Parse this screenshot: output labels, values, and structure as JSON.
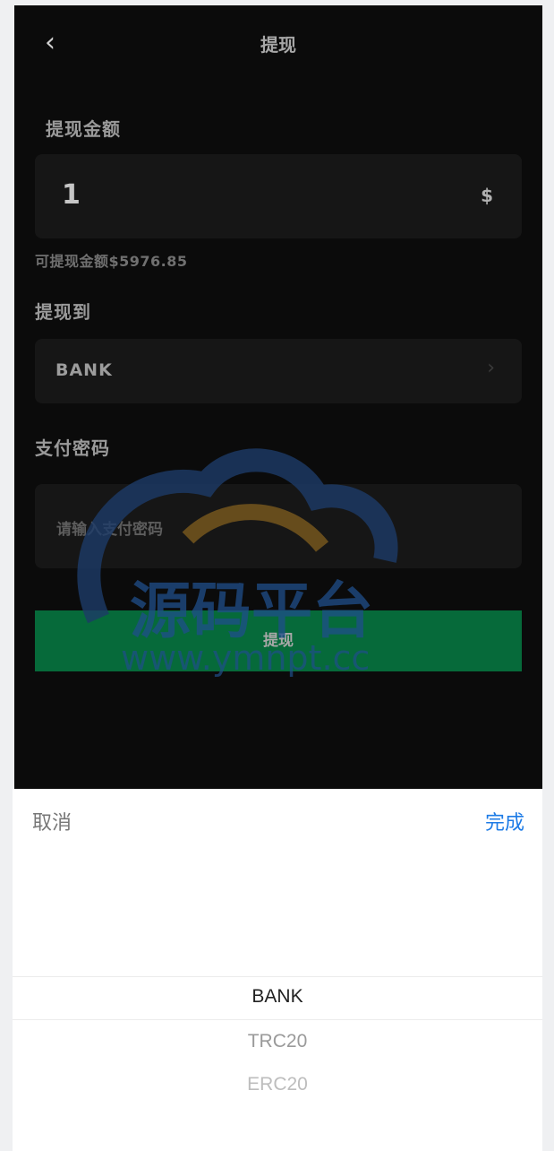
{
  "header": {
    "title": "提现",
    "back_icon": "chevron-left-icon"
  },
  "amount": {
    "label": "提现金额",
    "value": "1",
    "currency": "$",
    "available": "可提现金额$5976.85"
  },
  "method": {
    "label": "提现到",
    "value": "BANK",
    "arrow_icon": "chevron-right-icon"
  },
  "password": {
    "label": "支付密码",
    "placeholder": "请输入支付密码"
  },
  "submit": {
    "label": "提现"
  },
  "watermark": {
    "text_cn": "源码平台",
    "text_url": "www.ymnpt.cc"
  },
  "picker": {
    "cancel": "取消",
    "done": "完成",
    "options": [
      "BANK",
      "TRC20",
      "ERC20"
    ],
    "selected": "BANK"
  },
  "colors": {
    "accent": "#1d7be6",
    "submit_bg": "#066a3a",
    "page_bg": "#0b0b0b"
  }
}
